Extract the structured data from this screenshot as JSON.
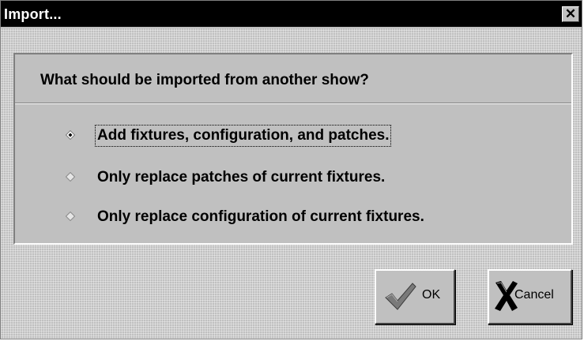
{
  "window": {
    "title": "Import...",
    "close_glyph": "✕"
  },
  "dialog": {
    "question": "What should be imported from another show?",
    "options": [
      {
        "label": "Add fixtures, configuration, and patches.",
        "selected": true
      },
      {
        "label": "Only replace patches of current fixtures.",
        "selected": false
      },
      {
        "label": "Only replace configuration of current fixtures.",
        "selected": false
      }
    ]
  },
  "buttons": {
    "ok": {
      "label": "OK",
      "icon": "checkmark-icon"
    },
    "cancel": {
      "label": "Cancel",
      "icon": "x-mark-icon"
    }
  },
  "colors": {
    "titlebar": "#000000",
    "face": "#c0c0c0",
    "check": "#7a7a7a",
    "cross": "#000000"
  }
}
